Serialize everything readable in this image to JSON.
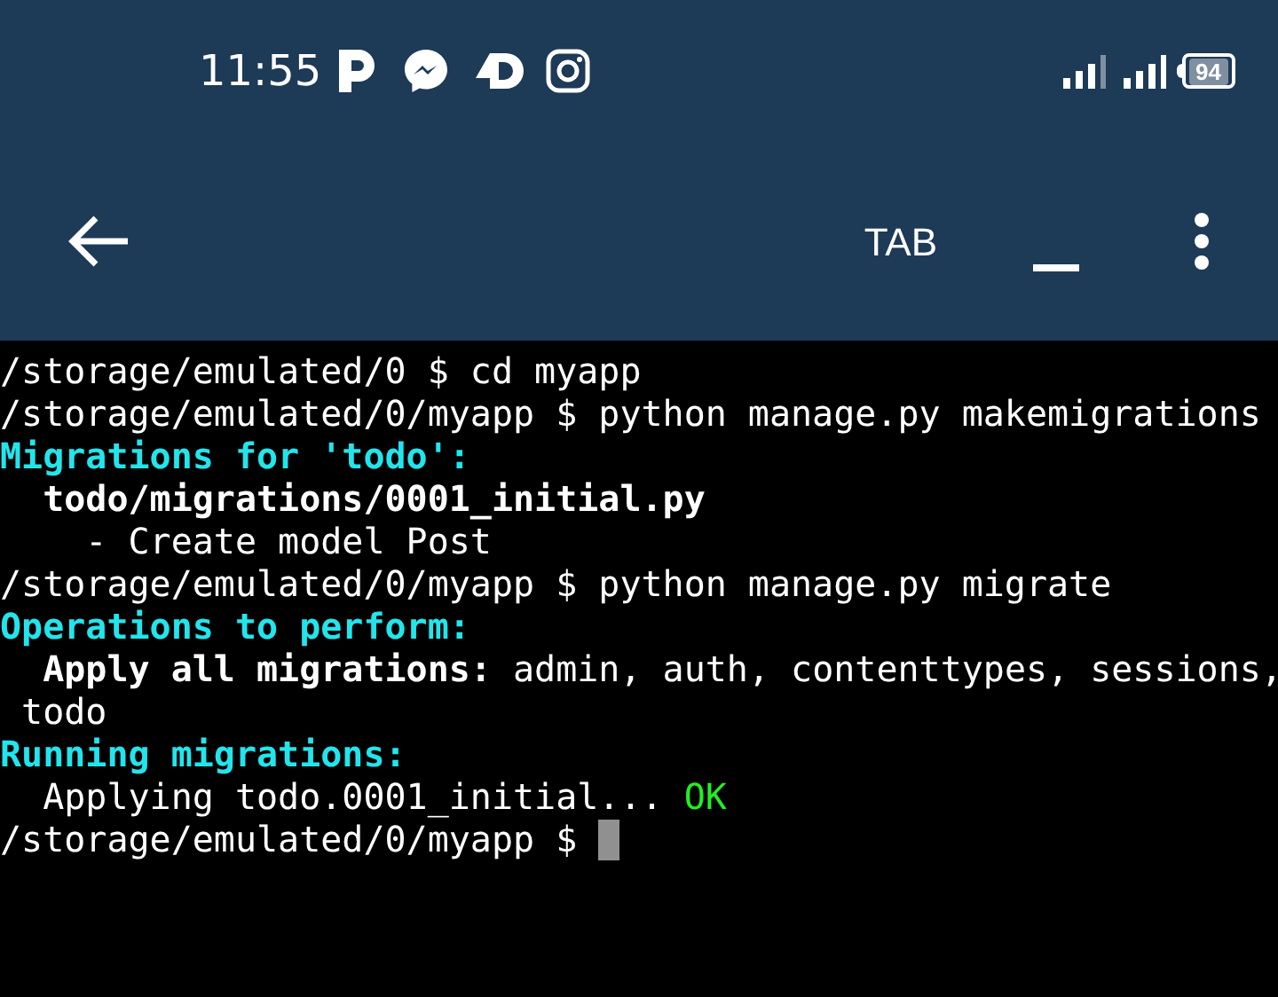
{
  "status_bar": {
    "time": "11:55",
    "battery": "94"
  },
  "toolbar": {
    "title": "TAB"
  },
  "terminal": {
    "lines": [
      {
        "segments": [
          {
            "kind": "plain",
            "text": "/storage/emulated/0 $ cd myapp"
          }
        ]
      },
      {
        "segments": [
          {
            "kind": "plain",
            "text": "/storage/emulated/0/myapp $ python manage.py makemigrations"
          }
        ]
      },
      {
        "segments": [
          {
            "kind": "heading",
            "text": "Migrations for 'todo':"
          }
        ]
      },
      {
        "segments": [
          {
            "kind": "bold",
            "text": "  todo/migrations/0001_initial.py"
          }
        ]
      },
      {
        "segments": [
          {
            "kind": "plain",
            "text": "    - Create model Post"
          }
        ]
      },
      {
        "segments": [
          {
            "kind": "plain",
            "text": "/storage/emulated/0/myapp $ python manage.py migrate"
          }
        ]
      },
      {
        "segments": [
          {
            "kind": "heading",
            "text": "Operations to perform:"
          }
        ]
      },
      {
        "segments": [
          {
            "kind": "bold",
            "text": "  Apply all migrations:"
          },
          {
            "kind": "plain",
            "text": " admin, auth, contenttypes, sessions,"
          }
        ]
      },
      {
        "segments": [
          {
            "kind": "plain",
            "text": " todo"
          }
        ]
      },
      {
        "segments": [
          {
            "kind": "heading",
            "text": "Running migrations:"
          }
        ]
      },
      {
        "segments": [
          {
            "kind": "plain",
            "text": "  Applying todo.0001_initial... "
          },
          {
            "kind": "success",
            "text": "OK"
          }
        ]
      },
      {
        "segments": [
          {
            "kind": "plain",
            "text": "/storage/emulated/0/myapp $ "
          }
        ],
        "cursor": true
      }
    ]
  }
}
